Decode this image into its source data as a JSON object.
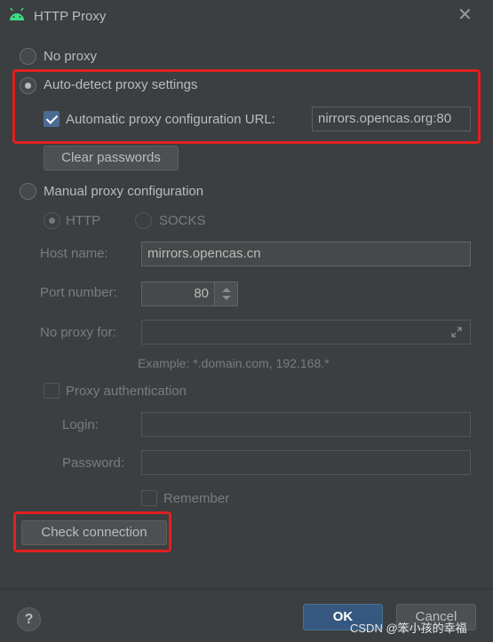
{
  "window": {
    "title": "HTTP Proxy"
  },
  "options": {
    "no_proxy": "No proxy",
    "auto_detect": "Auto-detect proxy settings",
    "auto_config_url_label": "Automatic proxy configuration URL:",
    "auto_config_url_value": "nirrors.opencas.org:80",
    "clear_passwords": "Clear passwords",
    "manual": "Manual proxy configuration"
  },
  "manual": {
    "http": "HTTP",
    "socks": "SOCKS",
    "host_label": "Host name:",
    "host_value": "mirrors.opencas.cn",
    "port_label": "Port number:",
    "port_value": "80",
    "no_proxy_label": "No proxy for:",
    "no_proxy_value": "",
    "example": "Example: *.domain.com, 192.168.*",
    "auth_label": "Proxy authentication",
    "login_label": "Login:",
    "password_label": "Password:",
    "remember": "Remember"
  },
  "actions": {
    "check_connection": "Check connection",
    "help": "?",
    "ok": "OK",
    "cancel": "Cancel"
  },
  "watermark": "CSDN @笨小孩的幸福",
  "colors": {
    "background": "#3c3f41",
    "accent": "#365880",
    "highlight": "#e02020",
    "android": "#3ddc84"
  },
  "icons": {
    "app": "android-icon",
    "close": "close-icon",
    "expand": "expand-icon",
    "help": "help-icon"
  }
}
